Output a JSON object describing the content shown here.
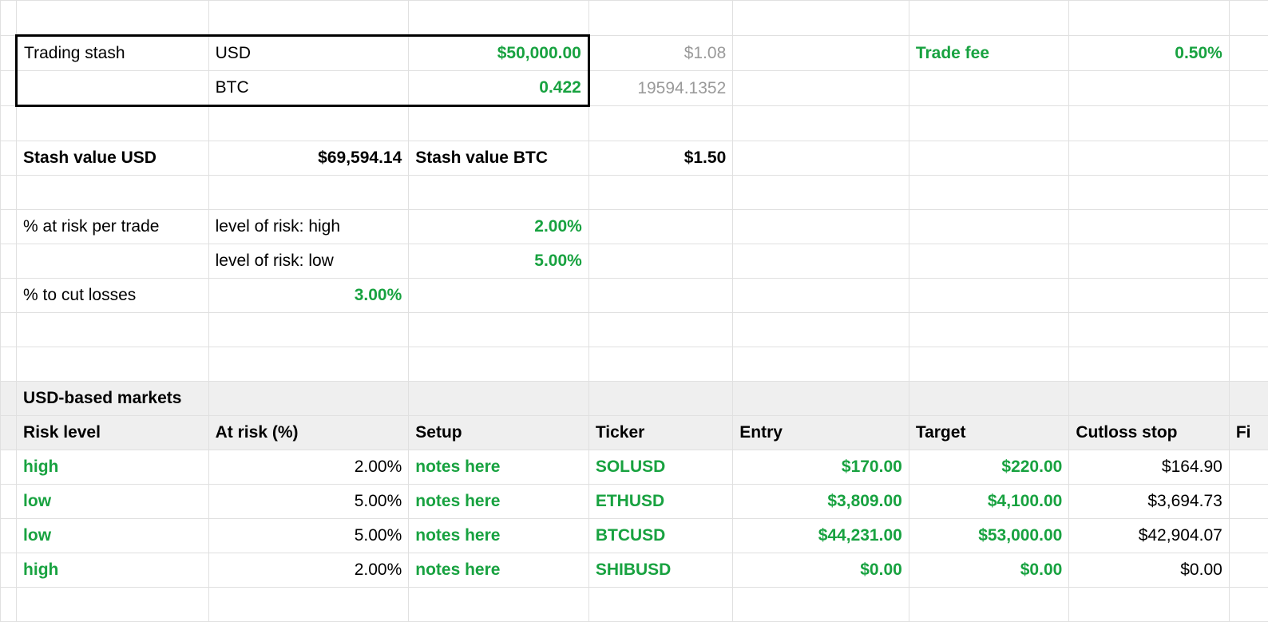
{
  "stash": {
    "label": "Trading stash",
    "usd_label": "USD",
    "usd_value": "$50,000.00",
    "usd_rate": "$1.08",
    "btc_label": "BTC",
    "btc_value": "0.422",
    "btc_rate": "19594.1352"
  },
  "fee": {
    "label": "Trade fee",
    "value": "0.50%"
  },
  "valuation": {
    "usd_label": "Stash value USD",
    "usd_value": "$69,594.14",
    "btc_label": "Stash value BTC",
    "btc_value": "$1.50"
  },
  "risk": {
    "per_trade_label": "% at risk per trade",
    "high_label": "level of risk: high",
    "high_value": "2.00%",
    "low_label": "level of risk: low",
    "low_value": "5.00%",
    "cut_label": "% to cut losses",
    "cut_value": "3.00%"
  },
  "markets": {
    "section": "USD-based markets",
    "headers": {
      "risk": "Risk level",
      "atrisk": "At risk (%)",
      "setup": "Setup",
      "ticker": "Ticker",
      "entry": "Entry",
      "target": "Target",
      "cutloss": "Cutloss stop",
      "final": "Fi"
    },
    "rows": [
      {
        "risk": "high",
        "atrisk": "2.00%",
        "setup": "notes here",
        "ticker": "SOLUSD",
        "entry": "$170.00",
        "target": "$220.00",
        "cutloss": "$164.90"
      },
      {
        "risk": "low",
        "atrisk": "5.00%",
        "setup": "notes here",
        "ticker": "ETHUSD",
        "entry": "$3,809.00",
        "target": "$4,100.00",
        "cutloss": "$3,694.73"
      },
      {
        "risk": "low",
        "atrisk": "5.00%",
        "setup": "notes here",
        "ticker": "BTCUSD",
        "entry": "$44,231.00",
        "target": "$53,000.00",
        "cutloss": "$42,904.07"
      },
      {
        "risk": "high",
        "atrisk": "2.00%",
        "setup": "notes here",
        "ticker": "SHIBUSD",
        "entry": "$0.00",
        "target": "$0.00",
        "cutloss": "$0.00"
      }
    ]
  }
}
